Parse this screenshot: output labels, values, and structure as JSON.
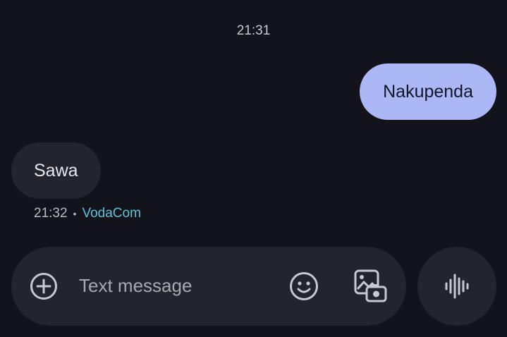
{
  "conversation": {
    "top_timestamp": "21:31",
    "messages": [
      {
        "direction": "outgoing",
        "text": "Nakupenda"
      },
      {
        "direction": "incoming",
        "text": "Sawa"
      }
    ],
    "incoming_meta": {
      "time": "21:32",
      "separator": "•",
      "carrier": "VodaCom"
    }
  },
  "composer": {
    "placeholder": "Text message",
    "icons": {
      "attach": "add-circle-icon",
      "emoji": "emoji-icon",
      "gallery": "gallery-icon",
      "voice": "voice-waveform-icon"
    }
  },
  "colors": {
    "background": "#13141b",
    "outgoing_bubble": "#acb7f5",
    "incoming_bubble": "#23242e",
    "carrier_link": "#5ec2d6"
  }
}
